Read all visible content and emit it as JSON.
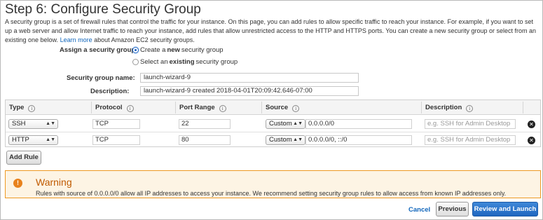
{
  "page": {
    "title": "Step 6: Configure Security Group",
    "intro": "A security group is a set of firewall rules that control the traffic for your instance. On this page, you can add rules to allow specific traffic to reach your instance. For example, if you want to set up a web server and allow Internet traffic to reach your instance, add rules that allow unrestricted access to the HTTP and HTTPS ports. You can create a new security group or select from an existing one below.",
    "learn_more": "Learn more",
    "intro_tail": "about Amazon EC2 security groups."
  },
  "assign": {
    "label": "Assign a security group:",
    "option_create": {
      "pre": "Create a ",
      "bold": "new",
      "post": " security group",
      "selected": true
    },
    "option_existing": {
      "pre": "Select an ",
      "bold": "existing",
      "post": " security group",
      "selected": false
    }
  },
  "group": {
    "name_label": "Security group name:",
    "name_value": "launch-wizard-9",
    "desc_label": "Description:",
    "desc_value": "launch-wizard-9 created 2018-04-01T20:09:42.646-07:00"
  },
  "rules_table": {
    "headers": {
      "type": "Type",
      "protocol": "Protocol",
      "port_range": "Port Range",
      "source": "Source",
      "description": "Description"
    },
    "info_glyph": "i",
    "rows": [
      {
        "type": "SSH",
        "protocol": "TCP",
        "port_range": "22",
        "source_type": "Custom",
        "source_value": "0.0.0.0/0",
        "description_placeholder": "e.g. SSH for Admin Desktop"
      },
      {
        "type": "HTTP",
        "protocol": "TCP",
        "port_range": "80",
        "source_type": "Custom",
        "source_value": "0.0.0.0/0, ::/0",
        "description_placeholder": "e.g. SSH for Admin Desktop"
      }
    ],
    "remove_glyph": "✕"
  },
  "add_rule_label": "Add Rule",
  "warning": {
    "title": "Warning",
    "message": "Rules with source of 0.0.0.0/0 allow all IP addresses to access your instance. We recommend setting security group rules to allow access from known IP addresses only.",
    "icon": "!"
  },
  "footer": {
    "cancel_label": "Cancel",
    "previous_label": "Previous",
    "launch_label": "Review and Launch"
  },
  "colors": {
    "link": "#1166bb",
    "primary_button": "#2067c0",
    "warning_border": "#ee9922",
    "warning_bg": "#fdf4e4"
  }
}
